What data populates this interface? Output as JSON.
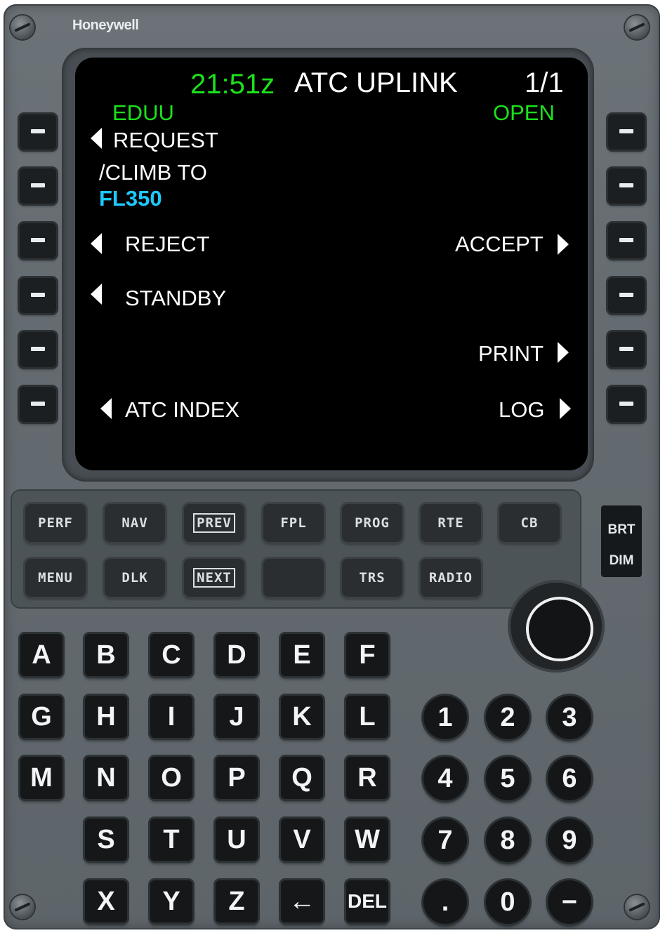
{
  "brand": "Honeywell",
  "display": {
    "time": "21:51z",
    "title": "ATC UPLINK",
    "page": "1/1",
    "station": "EDUU",
    "status": "OPEN",
    "l1": "REQUEST",
    "msg_line1": "/CLIMB TO",
    "msg_line2": "FL350",
    "l3": "REJECT",
    "r3": "ACCEPT",
    "l4": "STANDBY",
    "r5": "PRINT",
    "l6": "ATC INDEX",
    "r6": "LOG"
  },
  "function_keys": {
    "row1": [
      "PERF",
      "NAV",
      "PREV",
      "FPL",
      "PROG",
      "RTE",
      "CB"
    ],
    "row2": [
      "MENU",
      "DLK",
      "NEXT",
      "",
      "TRS",
      "RADIO"
    ]
  },
  "brightness": {
    "brt": "BRT",
    "dim": "DIM"
  },
  "alpha_keys": [
    "A",
    "B",
    "C",
    "D",
    "E",
    "F",
    "G",
    "H",
    "I",
    "J",
    "K",
    "L",
    "M",
    "N",
    "O",
    "P",
    "Q",
    "R",
    "S",
    "T",
    "U",
    "V",
    "W",
    "X",
    "Y",
    "Z",
    "←",
    "DEL"
  ],
  "num_keys": [
    "1",
    "2",
    "3",
    "4",
    "5",
    "6",
    "7",
    "8",
    "9",
    ".",
    "0",
    "−"
  ],
  "colors": {
    "green": "#1be21b",
    "cyan": "#1ec8ff",
    "white": "#ffffff"
  }
}
